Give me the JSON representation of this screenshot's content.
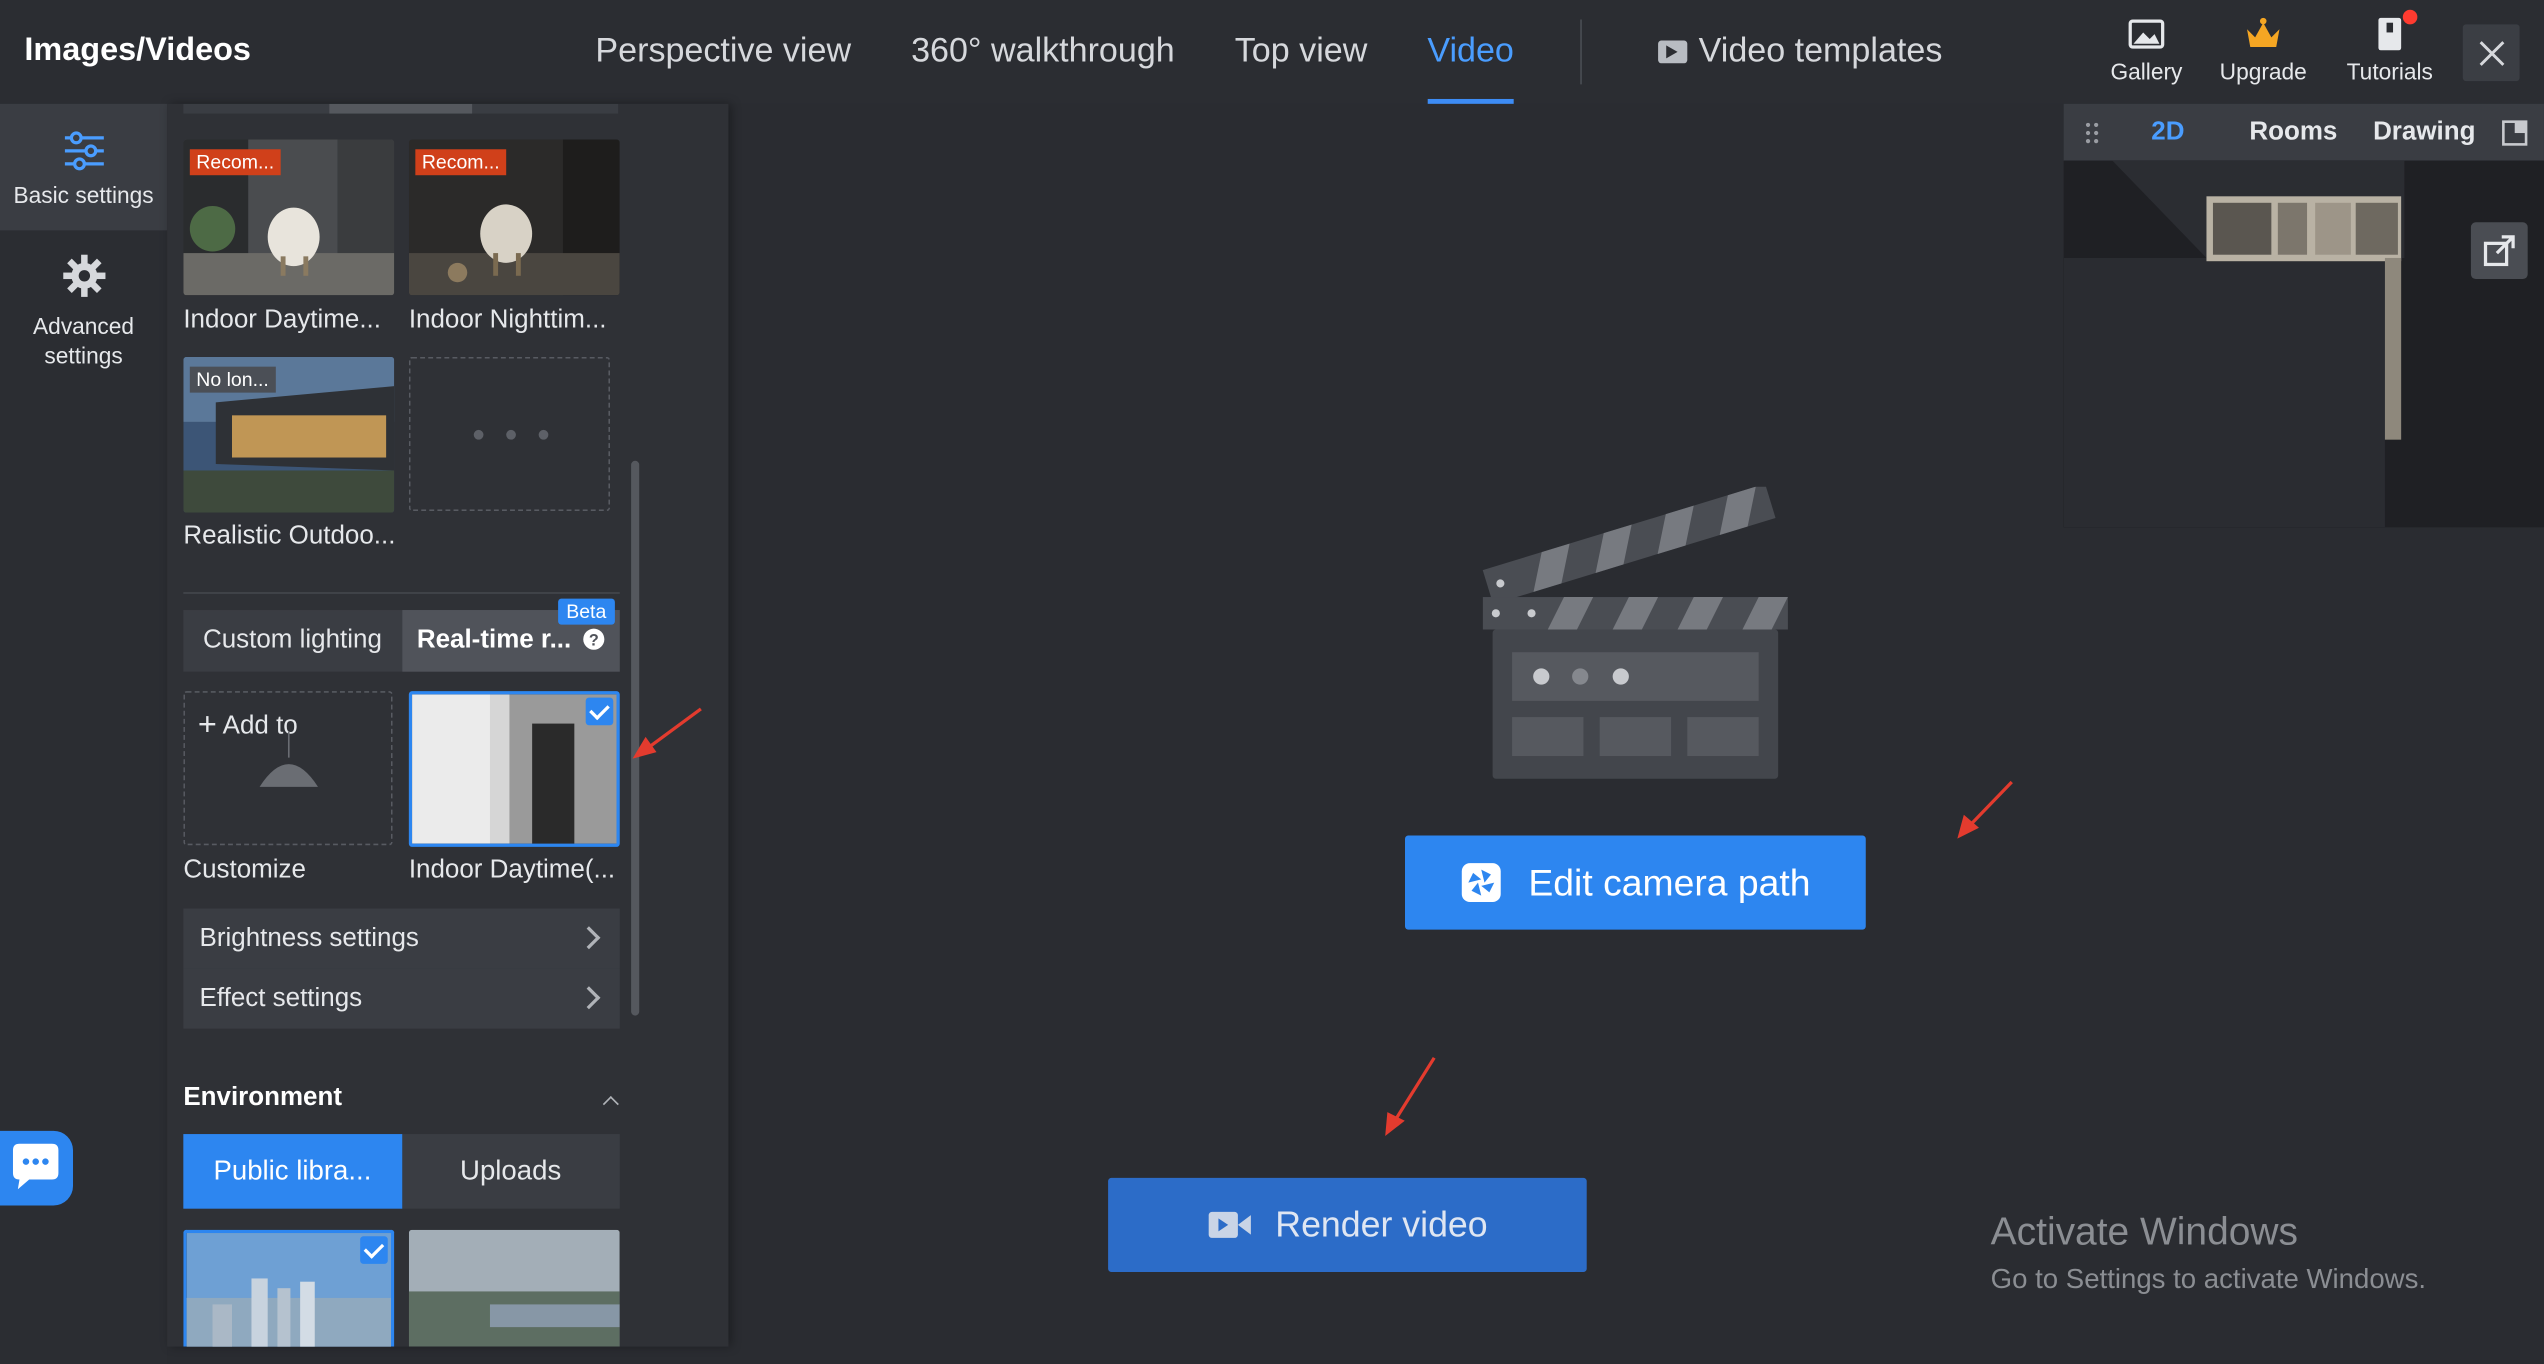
{
  "app": {
    "title": "Images/Videos"
  },
  "tabs": [
    {
      "label": "Perspective view",
      "active": false
    },
    {
      "label": "360° walkthrough",
      "active": false
    },
    {
      "label": "Top view",
      "active": false
    },
    {
      "label": "Video",
      "active": true
    }
  ],
  "templates_tab": {
    "label": "Video templates",
    "icon": "video-template-icon"
  },
  "tools": {
    "gallery": "Gallery",
    "upgrade": "Upgrade",
    "tutorials": "Tutorials"
  },
  "rail": {
    "basic": "Basic settings",
    "advanced_line1": "Advanced",
    "advanced_line2": "settings"
  },
  "presets": [
    {
      "label": "Indoor Daytime...",
      "tag": "Recom..."
    },
    {
      "label": "Indoor Nighttim...",
      "tag": "Recom..."
    },
    {
      "label": "Realistic Outdoo...",
      "tag": "No lon..."
    }
  ],
  "lighting": {
    "tab_custom": "Custom lighting",
    "tab_realtime": "Real-time r...",
    "beta": "Beta",
    "add_to": "Add to",
    "customize": "Customize",
    "selected_label": "Indoor Daytime(..."
  },
  "settings_rows": {
    "brightness": "Brightness settings",
    "effect": "Effect settings"
  },
  "environment": {
    "title": "Environment",
    "tab_public": "Public libra...",
    "tab_uploads": "Uploads"
  },
  "center": {
    "edit_camera": "Edit camera path",
    "render_video": "Render video"
  },
  "minimap": {
    "tab_2d": "2D",
    "tab_rooms": "Rooms",
    "tab_drawing": "Drawing"
  },
  "watermark": {
    "title": "Activate Windows",
    "subtitle": "Go to Settings to activate Windows."
  },
  "colors": {
    "accent": "#2d86f0",
    "active_tab": "#4a9dff",
    "tag_red": "#d0401a"
  }
}
